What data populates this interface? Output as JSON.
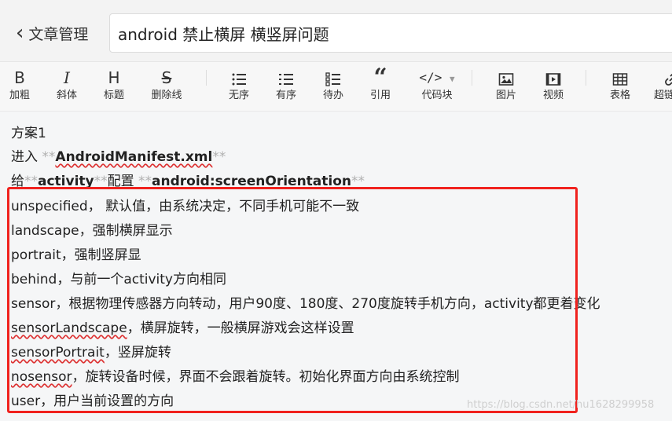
{
  "header": {
    "back_label": "文章管理",
    "title_value": "android 禁止横屏 横竖屏问题"
  },
  "toolbar": {
    "bold": "加粗",
    "italic": "斜体",
    "heading": "标题",
    "strike": "删除线",
    "ul": "无序",
    "ol": "有序",
    "todo": "待办",
    "quote": "引用",
    "code": "代码块",
    "image": "图片",
    "video": "视频",
    "table": "表格",
    "more": "超链"
  },
  "content": {
    "l1": "方案1",
    "l2_prefix": "进入 ",
    "l2_md1": "**",
    "l2_bold": "AndroidManifest.xml",
    "l2_md2": "**",
    "l3_prefix": "给",
    "l3_md1": "**",
    "l3_bold1": "activity",
    "l3_md2": "**",
    "l3_mid": "配置 ",
    "l3_md3": "**",
    "l3_bold2": "android:screenOrientation",
    "l3_md4": "**",
    "l4": "unspecified， 默认值，由系统决定，不同手机可能不一致",
    "l5": "landscape，强制横屏显示",
    "l6": "portrait，强制竖屏显",
    "l7": "behind，与前一个activity方向相同",
    "l8": "sensor，根据物理传感器方向转动，用户90度、180度、270度旋转手机方向，activity都更着变化",
    "l9_key": "sensorLandscape",
    "l9_rest": "，横屏旋转，一般横屏游戏会这样设置",
    "l10_key": "sensorPortrait",
    "l10_rest": "，竖屏旋转",
    "l11_key": "nosensor",
    "l11_rest": "，旋转设备时候，界面不会跟着旋转。初始化界面方向由系统控制",
    "l12": "user，用户当前设置的方向"
  },
  "watermark": "https://blog.csdn.net/hu1628299958",
  "colors": {
    "highlight_box": "#f0221e",
    "spellcheck": "#d33"
  }
}
